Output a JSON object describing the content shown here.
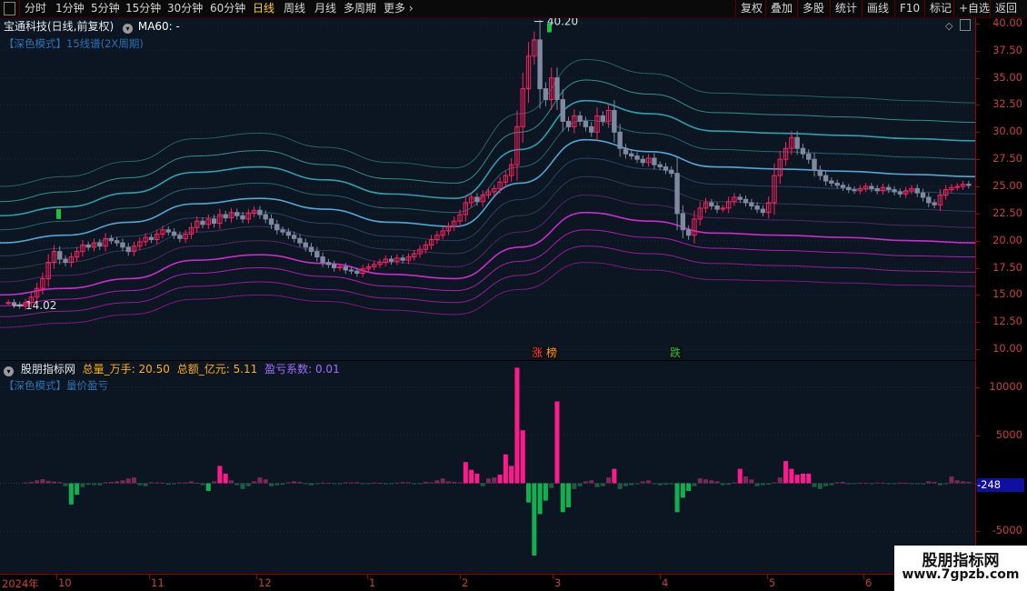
{
  "toolbar": {
    "left": [
      "分时",
      "1分钟",
      "5分钟",
      "15分钟",
      "30分钟",
      "60分钟",
      "日线",
      "周线",
      "月线",
      "多周期",
      "更多"
    ],
    "active": "日线",
    "right": [
      "复权",
      "叠加",
      "多股",
      "统计",
      "画线",
      "F10",
      "标记",
      "+自选",
      "返回"
    ]
  },
  "main": {
    "stock_title": "宝通科技(日线,前复权)",
    "ma_label": "MA60: -",
    "subtitle": "【深色模式】15线谱(2X周期)",
    "high_label": "40.20",
    "low_label": "14.02",
    "markers": [
      {
        "text": "涨",
        "color": "#ff3b3b"
      },
      {
        "text": "榜",
        "color": "#ff9a00"
      },
      {
        "text": "跌",
        "color": "#20c040"
      }
    ]
  },
  "sub": {
    "title": "股朋指标网",
    "items": [
      {
        "label": "总量_万手: 20.50",
        "color": "#ffb000"
      },
      {
        "label": "总额_亿元: 5.11",
        "color": "#ffb000"
      },
      {
        "label": "盈亏系数: 0.01",
        "color": "#a070ff"
      }
    ],
    "subtitle": "【深色模式】量价盈亏",
    "last_value": "-248"
  },
  "dates": [
    "2024年",
    "10",
    "11",
    "12",
    "1",
    "2",
    "3",
    "4",
    "5",
    "6"
  ],
  "watermark": {
    "line1": "股朋指标网",
    "line2": "www.7gpzb.com"
  },
  "chart_data": [
    {
      "type": "candlestick",
      "title": "宝通科技(日线,前复权)",
      "y_ticks": [
        10.0,
        12.5,
        15.0,
        17.5,
        20.0,
        22.5,
        25.0,
        27.5,
        30.0,
        32.5,
        35.0,
        37.5,
        40.0
      ],
      "ylim": [
        9.0,
        40.5
      ],
      "annotated_high": 40.2,
      "annotated_low": 14.02,
      "closes": [
        14.3,
        14.1,
        14.0,
        14.3,
        14.8,
        15.6,
        16.5,
        18.0,
        19.0,
        18.3,
        18.0,
        18.5,
        19.0,
        19.6,
        19.4,
        19.8,
        19.5,
        20.2,
        20.0,
        19.8,
        19.4,
        19.0,
        19.5,
        19.9,
        20.3,
        20.1,
        20.6,
        21.0,
        20.8,
        20.5,
        20.2,
        20.6,
        21.2,
        21.8,
        21.5,
        22.0,
        21.6,
        22.4,
        22.1,
        22.6,
        22.3,
        22.0,
        22.5,
        22.8,
        22.4,
        22.0,
        21.5,
        21.0,
        20.8,
        20.5,
        20.2,
        19.8,
        19.4,
        19.0,
        18.5,
        18.0,
        17.8,
        17.5,
        17.6,
        17.3,
        17.2,
        17.0,
        17.4,
        17.6,
        17.8,
        18.0,
        18.3,
        18.1,
        18.4,
        18.2,
        18.5,
        18.8,
        19.2,
        19.6,
        20.1,
        20.5,
        20.9,
        21.3,
        21.8,
        22.4,
        23.5,
        24.0,
        23.6,
        24.2,
        24.5,
        24.8,
        25.4,
        26.0,
        27.0,
        30.5,
        34.0,
        37.0,
        38.5,
        34.0,
        33.0,
        35.0,
        33.0,
        31.0,
        30.5,
        31.5,
        31.0,
        30.5,
        30.0,
        31.5,
        31.0,
        32.0,
        30.0,
        28.5,
        28.0,
        27.8,
        27.5,
        27.2,
        27.6,
        27.0,
        26.8,
        26.5,
        26.2,
        22.5,
        21.0,
        20.5,
        22.0,
        23.0,
        23.5,
        23.2,
        22.9,
        23.0,
        23.6,
        24.0,
        23.8,
        23.5,
        23.2,
        22.9,
        22.6,
        23.5,
        26.0,
        27.5,
        28.5,
        29.5,
        28.5,
        28.0,
        27.5,
        26.5,
        26.0,
        25.5,
        25.3,
        25.1,
        24.9,
        24.7,
        24.6,
        24.8,
        25.0,
        24.8,
        24.6,
        24.9,
        24.7,
        24.5,
        24.3,
        24.6,
        24.8,
        24.4,
        24.0,
        23.5,
        23.3,
        24.2,
        24.7,
        24.9,
        25.0,
        25.2,
        25.1
      ],
      "bands": [
        {
          "name": "band-1",
          "values": [
            12.0,
            12.4,
            13.2,
            14.6,
            15.0,
            14.4,
            13.6,
            13.2,
            15.5,
            18.0,
            17.3,
            16.4,
            16.3,
            16.1,
            15.9,
            15.8
          ]
        },
        {
          "name": "band-2",
          "values": [
            13.0,
            13.5,
            14.3,
            15.8,
            16.2,
            15.5,
            14.7,
            14.3,
            16.8,
            19.5,
            18.8,
            17.9,
            17.7,
            17.5,
            17.2,
            17.1
          ]
        },
        {
          "name": "band-3",
          "values": [
            14.0,
            14.6,
            15.4,
            17.0,
            17.5,
            16.7,
            15.8,
            15.4,
            18.1,
            21.0,
            20.3,
            19.3,
            19.1,
            18.9,
            18.6,
            18.5
          ]
        },
        {
          "name": "band-4",
          "values": [
            15.0,
            15.6,
            16.5,
            18.2,
            18.7,
            17.9,
            16.9,
            16.5,
            19.4,
            22.6,
            21.8,
            20.7,
            20.5,
            20.3,
            20.0,
            19.8
          ]
        },
        {
          "name": "band-5",
          "values": [
            16.2,
            16.8,
            17.8,
            19.5,
            20.0,
            19.1,
            18.0,
            17.6,
            20.8,
            24.2,
            23.3,
            22.1,
            21.9,
            21.7,
            21.4,
            21.2
          ]
        },
        {
          "name": "band-6",
          "values": [
            17.4,
            18.0,
            19.1,
            20.8,
            21.3,
            20.3,
            19.2,
            18.8,
            22.3,
            25.9,
            24.9,
            23.6,
            23.4,
            23.2,
            22.9,
            22.7
          ]
        },
        {
          "name": "band-7",
          "values": [
            18.6,
            19.3,
            20.4,
            22.1,
            22.6,
            21.6,
            20.4,
            20.0,
            23.8,
            27.6,
            26.6,
            25.2,
            25.0,
            24.8,
            24.5,
            24.3
          ]
        },
        {
          "name": "band-8",
          "values": [
            19.8,
            20.5,
            21.7,
            23.4,
            23.9,
            22.9,
            21.7,
            21.3,
            25.3,
            29.3,
            28.2,
            26.8,
            26.6,
            26.4,
            26.1,
            25.9
          ]
        },
        {
          "name": "band-9",
          "values": [
            21.0,
            21.8,
            23.0,
            24.8,
            25.3,
            24.2,
            23.0,
            22.6,
            26.8,
            31.1,
            29.9,
            28.4,
            28.2,
            28.0,
            27.7,
            27.5
          ]
        },
        {
          "name": "band-10",
          "values": [
            22.3,
            23.1,
            24.4,
            26.3,
            26.8,
            25.6,
            24.3,
            23.9,
            28.4,
            32.9,
            31.7,
            30.1,
            29.9,
            29.7,
            29.4,
            29.2
          ]
        },
        {
          "name": "band-11",
          "values": [
            23.6,
            24.5,
            25.8,
            27.8,
            28.3,
            27.0,
            25.7,
            25.3,
            30.0,
            34.8,
            33.5,
            31.8,
            31.6,
            31.4,
            31.1,
            30.9
          ]
        },
        {
          "name": "band-12",
          "values": [
            25.0,
            25.9,
            27.3,
            29.4,
            29.9,
            28.6,
            27.2,
            26.7,
            31.7,
            36.7,
            35.4,
            33.6,
            33.4,
            33.2,
            32.9,
            32.7
          ]
        }
      ]
    },
    {
      "type": "bar",
      "title": "量价盈亏",
      "y_ticks": [
        -5000,
        0,
        5000,
        10000
      ],
      "ylim": [
        -9300,
        12700
      ],
      "values": [
        0,
        0,
        0,
        80,
        150,
        300,
        420,
        250,
        180,
        120,
        -300,
        -2200,
        -1200,
        -400,
        -150,
        -180,
        -200,
        100,
        150,
        200,
        300,
        500,
        600,
        -200,
        -300,
        100,
        80,
        60,
        -150,
        -100,
        80,
        100,
        200,
        50,
        -200,
        -800,
        200,
        1800,
        1000,
        300,
        -200,
        -600,
        -300,
        200,
        600,
        400,
        -300,
        -200,
        -150,
        100,
        200,
        150,
        -100,
        -200,
        -80,
        60,
        40,
        -60,
        -80,
        100,
        80,
        120,
        -100,
        -80,
        60,
        40,
        -50,
        -60,
        80,
        120,
        100,
        -100,
        -80,
        150,
        100,
        300,
        500,
        200,
        150,
        100,
        2200,
        1400,
        1000,
        -300,
        500,
        600,
        900,
        3000,
        1800,
        12000,
        5500,
        -2000,
        -7500,
        -3200,
        -1800,
        -500,
        8500,
        -3000,
        -2500,
        -600,
        -300,
        200,
        300,
        -400,
        -300,
        600,
        1500,
        -600,
        -300,
        -200,
        -100,
        200,
        300,
        -100,
        -200,
        -150,
        -100,
        -3000,
        -1500,
        -800,
        -300,
        500,
        400,
        300,
        200,
        -200,
        -150,
        100,
        1500,
        700,
        400,
        -300,
        -200,
        -150,
        100,
        600,
        2300,
        1500,
        900,
        1000,
        1000,
        -400,
        -600,
        -300,
        -200,
        100,
        150,
        -100,
        -80,
        60,
        40,
        -50,
        80,
        60,
        -40,
        -50,
        60,
        40,
        -30,
        -60,
        -100,
        200,
        150,
        -200,
        -100,
        700,
        300,
        200,
        150
      ]
    }
  ]
}
